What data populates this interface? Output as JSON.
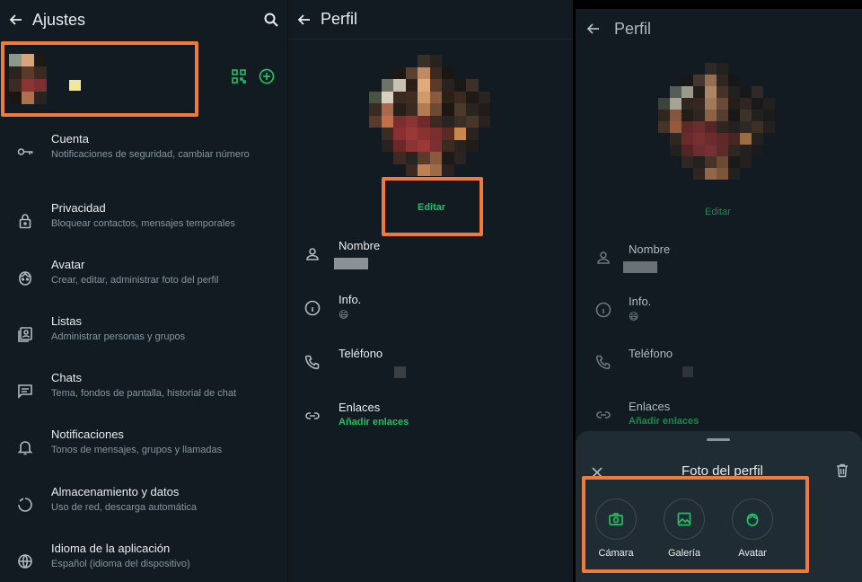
{
  "settings": {
    "title": "Ajustes",
    "items": [
      {
        "title": "Cuenta",
        "subtitle": "Notificaciones de seguridad, cambiar número",
        "icon": "key-icon"
      },
      {
        "title": "Privacidad",
        "subtitle": "Bloquear contactos, mensajes temporales",
        "icon": "lock-icon"
      },
      {
        "title": "Avatar",
        "subtitle": "Crear, editar, administrar foto del perfil",
        "icon": "avatar-icon"
      },
      {
        "title": "Listas",
        "subtitle": "Administrar personas y grupos",
        "icon": "contacts-icon"
      },
      {
        "title": "Chats",
        "subtitle": "Tema, fondos de pantalla, historial de chat",
        "icon": "chat-icon"
      },
      {
        "title": "Notificaciones",
        "subtitle": "Tonos de mensajes, grupos y llamadas",
        "icon": "bell-icon"
      },
      {
        "title": "Almacenamiento y datos",
        "subtitle": "Uso de red, descarga automática",
        "icon": "storage-icon"
      },
      {
        "title": "Idioma de la aplicación",
        "subtitle": "Español (idioma del dispositivo)",
        "icon": "globe-icon"
      }
    ]
  },
  "profile": {
    "title": "Perfil",
    "edit_label": "Editar",
    "fields": [
      {
        "label": "Nombre",
        "value": "",
        "icon": "person-icon"
      },
      {
        "label": "Info.",
        "value": "😄",
        "icon": "info-icon"
      },
      {
        "label": "Teléfono",
        "value": "",
        "icon": "phone-icon"
      },
      {
        "label": "Enlaces",
        "value": "Añadir enlaces",
        "icon": "link-icon"
      }
    ]
  },
  "photo_sheet": {
    "title": "Foto del perfil",
    "options": [
      {
        "label": "Cámara",
        "icon": "camera-icon"
      },
      {
        "label": "Galería",
        "icon": "gallery-icon"
      },
      {
        "label": "Avatar",
        "icon": "avatar-icon"
      }
    ]
  },
  "colors": {
    "background": "#111b21",
    "accent": "#21c063",
    "highlight": "#f07a3c",
    "sheet": "#1f2c33"
  }
}
